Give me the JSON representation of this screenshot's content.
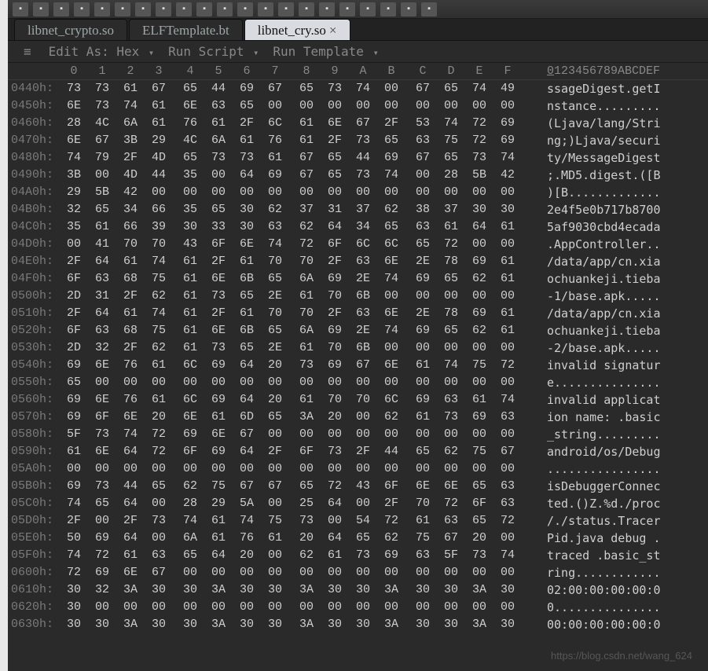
{
  "toolbar_icons": [
    "new",
    "open",
    "save",
    "save-as",
    "undo",
    "redo",
    "cut",
    "copy",
    "paste",
    "find",
    "hex",
    "ascii",
    "goto",
    "calc",
    "struct",
    "run",
    "stop",
    "help",
    "view-1",
    "view-2",
    "view-3"
  ],
  "tabs": [
    {
      "label": "libnet_crypto.so",
      "active": false,
      "close": false
    },
    {
      "label": "ELFTemplate.bt",
      "active": false,
      "close": false
    },
    {
      "label": "libnet_cry.so",
      "active": true,
      "close": true
    }
  ],
  "menubar": {
    "burger": "≡",
    "edit_as": "Edit As:",
    "edit_as_val": "Hex",
    "run_script": "Run Script",
    "run_template": "Run Template"
  },
  "hex_header": [
    "0",
    "1",
    "2",
    "3",
    "4",
    "5",
    "6",
    "7",
    "8",
    "9",
    "A",
    "B",
    "C",
    "D",
    "E",
    "F"
  ],
  "ascii_header": "0123456789ABCDEF",
  "rows": [
    {
      "addr": "0440h:",
      "hex": [
        "73",
        "73",
        "61",
        "67",
        "65",
        "44",
        "69",
        "67",
        "65",
        "73",
        "74",
        "00",
        "67",
        "65",
        "74",
        "49"
      ],
      "ascii": "ssageDigest.getI"
    },
    {
      "addr": "0450h:",
      "hex": [
        "6E",
        "73",
        "74",
        "61",
        "6E",
        "63",
        "65",
        "00",
        "00",
        "00",
        "00",
        "00",
        "00",
        "00",
        "00",
        "00"
      ],
      "ascii": "nstance........."
    },
    {
      "addr": "0460h:",
      "hex": [
        "28",
        "4C",
        "6A",
        "61",
        "76",
        "61",
        "2F",
        "6C",
        "61",
        "6E",
        "67",
        "2F",
        "53",
        "74",
        "72",
        "69"
      ],
      "ascii": "(Ljava/lang/Stri"
    },
    {
      "addr": "0470h:",
      "hex": [
        "6E",
        "67",
        "3B",
        "29",
        "4C",
        "6A",
        "61",
        "76",
        "61",
        "2F",
        "73",
        "65",
        "63",
        "75",
        "72",
        "69"
      ],
      "ascii": "ng;)Ljava/securi"
    },
    {
      "addr": "0480h:",
      "hex": [
        "74",
        "79",
        "2F",
        "4D",
        "65",
        "73",
        "73",
        "61",
        "67",
        "65",
        "44",
        "69",
        "67",
        "65",
        "73",
        "74"
      ],
      "ascii": "ty/MessageDigest"
    },
    {
      "addr": "0490h:",
      "hex": [
        "3B",
        "00",
        "4D",
        "44",
        "35",
        "00",
        "64",
        "69",
        "67",
        "65",
        "73",
        "74",
        "00",
        "28",
        "5B",
        "42"
      ],
      "ascii": ";.MD5.digest.([B"
    },
    {
      "addr": "04A0h:",
      "hex": [
        "29",
        "5B",
        "42",
        "00",
        "00",
        "00",
        "00",
        "00",
        "00",
        "00",
        "00",
        "00",
        "00",
        "00",
        "00",
        "00"
      ],
      "ascii": ")[B............."
    },
    {
      "addr": "04B0h:",
      "hex": [
        "32",
        "65",
        "34",
        "66",
        "35",
        "65",
        "30",
        "62",
        "37",
        "31",
        "37",
        "62",
        "38",
        "37",
        "30",
        "30"
      ],
      "ascii": "2e4f5e0b717b8700"
    },
    {
      "addr": "04C0h:",
      "hex": [
        "35",
        "61",
        "66",
        "39",
        "30",
        "33",
        "30",
        "63",
        "62",
        "64",
        "34",
        "65",
        "63",
        "61",
        "64",
        "61"
      ],
      "ascii": "5af9030cbd4ecada"
    },
    {
      "addr": "04D0h:",
      "hex": [
        "00",
        "41",
        "70",
        "70",
        "43",
        "6F",
        "6E",
        "74",
        "72",
        "6F",
        "6C",
        "6C",
        "65",
        "72",
        "00",
        "00"
      ],
      "ascii": ".AppController.."
    },
    {
      "addr": "04E0h:",
      "hex": [
        "2F",
        "64",
        "61",
        "74",
        "61",
        "2F",
        "61",
        "70",
        "70",
        "2F",
        "63",
        "6E",
        "2E",
        "78",
        "69",
        "61"
      ],
      "ascii": "/data/app/cn.xia"
    },
    {
      "addr": "04F0h:",
      "hex": [
        "6F",
        "63",
        "68",
        "75",
        "61",
        "6E",
        "6B",
        "65",
        "6A",
        "69",
        "2E",
        "74",
        "69",
        "65",
        "62",
        "61"
      ],
      "ascii": "ochuankeji.tieba"
    },
    {
      "addr": "0500h:",
      "hex": [
        "2D",
        "31",
        "2F",
        "62",
        "61",
        "73",
        "65",
        "2E",
        "61",
        "70",
        "6B",
        "00",
        "00",
        "00",
        "00",
        "00"
      ],
      "ascii": "-1/base.apk....."
    },
    {
      "addr": "0510h:",
      "hex": [
        "2F",
        "64",
        "61",
        "74",
        "61",
        "2F",
        "61",
        "70",
        "70",
        "2F",
        "63",
        "6E",
        "2E",
        "78",
        "69",
        "61"
      ],
      "ascii": "/data/app/cn.xia"
    },
    {
      "addr": "0520h:",
      "hex": [
        "6F",
        "63",
        "68",
        "75",
        "61",
        "6E",
        "6B",
        "65",
        "6A",
        "69",
        "2E",
        "74",
        "69",
        "65",
        "62",
        "61"
      ],
      "ascii": "ochuankeji.tieba"
    },
    {
      "addr": "0530h:",
      "hex": [
        "2D",
        "32",
        "2F",
        "62",
        "61",
        "73",
        "65",
        "2E",
        "61",
        "70",
        "6B",
        "00",
        "00",
        "00",
        "00",
        "00"
      ],
      "ascii": "-2/base.apk....."
    },
    {
      "addr": "0540h:",
      "hex": [
        "69",
        "6E",
        "76",
        "61",
        "6C",
        "69",
        "64",
        "20",
        "73",
        "69",
        "67",
        "6E",
        "61",
        "74",
        "75",
        "72"
      ],
      "ascii": "invalid signatur"
    },
    {
      "addr": "0550h:",
      "hex": [
        "65",
        "00",
        "00",
        "00",
        "00",
        "00",
        "00",
        "00",
        "00",
        "00",
        "00",
        "00",
        "00",
        "00",
        "00",
        "00"
      ],
      "ascii": "e..............."
    },
    {
      "addr": "0560h:",
      "hex": [
        "69",
        "6E",
        "76",
        "61",
        "6C",
        "69",
        "64",
        "20",
        "61",
        "70",
        "70",
        "6C",
        "69",
        "63",
        "61",
        "74"
      ],
      "ascii": "invalid applicat"
    },
    {
      "addr": "0570h:",
      "hex": [
        "69",
        "6F",
        "6E",
        "20",
        "6E",
        "61",
        "6D",
        "65",
        "3A",
        "20",
        "00",
        "62",
        "61",
        "73",
        "69",
        "63"
      ],
      "ascii": "ion name: .basic"
    },
    {
      "addr": "0580h:",
      "hex": [
        "5F",
        "73",
        "74",
        "72",
        "69",
        "6E",
        "67",
        "00",
        "00",
        "00",
        "00",
        "00",
        "00",
        "00",
        "00",
        "00"
      ],
      "ascii": "_string........."
    },
    {
      "addr": "0590h:",
      "hex": [
        "61",
        "6E",
        "64",
        "72",
        "6F",
        "69",
        "64",
        "2F",
        "6F",
        "73",
        "2F",
        "44",
        "65",
        "62",
        "75",
        "67"
      ],
      "ascii": "android/os/Debug"
    },
    {
      "addr": "05A0h:",
      "hex": [
        "00",
        "00",
        "00",
        "00",
        "00",
        "00",
        "00",
        "00",
        "00",
        "00",
        "00",
        "00",
        "00",
        "00",
        "00",
        "00"
      ],
      "ascii": "................"
    },
    {
      "addr": "05B0h:",
      "hex": [
        "69",
        "73",
        "44",
        "65",
        "62",
        "75",
        "67",
        "67",
        "65",
        "72",
        "43",
        "6F",
        "6E",
        "6E",
        "65",
        "63"
      ],
      "ascii": "isDebuggerConnec"
    },
    {
      "addr": "05C0h:",
      "hex": [
        "74",
        "65",
        "64",
        "00",
        "28",
        "29",
        "5A",
        "00",
        "25",
        "64",
        "00",
        "2F",
        "70",
        "72",
        "6F",
        "63"
      ],
      "ascii": "ted.()Z.%d./proc"
    },
    {
      "addr": "05D0h:",
      "hex": [
        "2F",
        "00",
        "2F",
        "73",
        "74",
        "61",
        "74",
        "75",
        "73",
        "00",
        "54",
        "72",
        "61",
        "63",
        "65",
        "72"
      ],
      "ascii": "/./status.Tracer"
    },
    {
      "addr": "05E0h:",
      "hex": [
        "50",
        "69",
        "64",
        "00",
        "6A",
        "61",
        "76",
        "61",
        "20",
        "64",
        "65",
        "62",
        "75",
        "67",
        "20",
        "00"
      ],
      "ascii": "Pid.java debug ."
    },
    {
      "addr": "05F0h:",
      "hex": [
        "74",
        "72",
        "61",
        "63",
        "65",
        "64",
        "20",
        "00",
        "62",
        "61",
        "73",
        "69",
        "63",
        "5F",
        "73",
        "74"
      ],
      "ascii": "traced .basic_st"
    },
    {
      "addr": "0600h:",
      "hex": [
        "72",
        "69",
        "6E",
        "67",
        "00",
        "00",
        "00",
        "00",
        "00",
        "00",
        "00",
        "00",
        "00",
        "00",
        "00",
        "00"
      ],
      "ascii": "ring............"
    },
    {
      "addr": "0610h:",
      "hex": [
        "30",
        "32",
        "3A",
        "30",
        "30",
        "3A",
        "30",
        "30",
        "3A",
        "30",
        "30",
        "3A",
        "30",
        "30",
        "3A",
        "30"
      ],
      "ascii": "02:00:00:00:00:0"
    },
    {
      "addr": "0620h:",
      "hex": [
        "30",
        "00",
        "00",
        "00",
        "00",
        "00",
        "00",
        "00",
        "00",
        "00",
        "00",
        "00",
        "00",
        "00",
        "00",
        "00"
      ],
      "ascii": "0..............."
    },
    {
      "addr": "0630h:",
      "hex": [
        "30",
        "30",
        "3A",
        "30",
        "30",
        "3A",
        "30",
        "30",
        "3A",
        "30",
        "30",
        "3A",
        "30",
        "30",
        "3A",
        "30"
      ],
      "ascii": "00:00:00:00:00:0"
    }
  ],
  "watermark": "https://blog.csdn.net/wang_624"
}
